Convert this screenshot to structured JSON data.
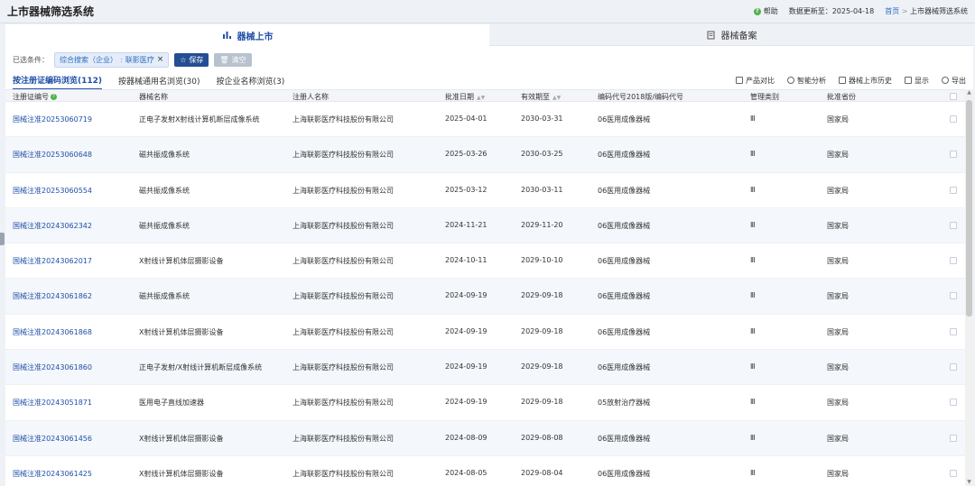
{
  "app": {
    "title": "上市器械筛选系统"
  },
  "topbar": {
    "help": "帮助",
    "update_label": "数据更新至：2025-04-18",
    "breadcrumb_home": "首页",
    "breadcrumb_sep": ">",
    "breadcrumb_current": "上市器械筛选系统"
  },
  "tabs": [
    {
      "label": "器械上市",
      "active": true
    },
    {
      "label": "器械备案",
      "active": false
    }
  ],
  "filters": {
    "label": "已选条件：",
    "chip_part1": "综合搜索（企业）",
    "chip_sep": ":",
    "chip_part2": "联影医疗",
    "save_label": "保存",
    "clear_label": "清空"
  },
  "browse_tabs": [
    {
      "label": "按注册证编码浏览(112)",
      "active": true
    },
    {
      "label": "按器械通用名浏览(30)",
      "active": false
    },
    {
      "label": "按企业名称浏览(3)",
      "active": false
    }
  ],
  "tools": [
    "产品对比",
    "智能分析",
    "器械上市历史",
    "显示",
    "导出"
  ],
  "table": {
    "headers": [
      "注册证编号",
      "器械名称",
      "注册人名称",
      "批准日期",
      "有效期至",
      "编码代号2018版/编码代号",
      "管理类别",
      "批准省份"
    ],
    "rows": [
      [
        "国械注准20253060719",
        "正电子发射X射线计算机断层成像系统",
        "上海联影医疗科技股份有限公司",
        "2025-04-01",
        "2030-03-31",
        "06医用成像器械",
        "Ⅲ",
        "国家局"
      ],
      [
        "国械注准20253060648",
        "磁共振成像系统",
        "上海联影医疗科技股份有限公司",
        "2025-03-26",
        "2030-03-25",
        "06医用成像器械",
        "Ⅲ",
        "国家局"
      ],
      [
        "国械注准20253060554",
        "磁共振成像系统",
        "上海联影医疗科技股份有限公司",
        "2025-03-12",
        "2030-03-11",
        "06医用成像器械",
        "Ⅲ",
        "国家局"
      ],
      [
        "国械注准20243062342",
        "磁共振成像系统",
        "上海联影医疗科技股份有限公司",
        "2024-11-21",
        "2029-11-20",
        "06医用成像器械",
        "Ⅲ",
        "国家局"
      ],
      [
        "国械注准20243062017",
        "X射线计算机体层摄影设备",
        "上海联影医疗科技股份有限公司",
        "2024-10-11",
        "2029-10-10",
        "06医用成像器械",
        "Ⅲ",
        "国家局"
      ],
      [
        "国械注准20243061862",
        "磁共振成像系统",
        "上海联影医疗科技股份有限公司",
        "2024-09-19",
        "2029-09-18",
        "06医用成像器械",
        "Ⅲ",
        "国家局"
      ],
      [
        "国械注准20243061868",
        "X射线计算机体层摄影设备",
        "上海联影医疗科技股份有限公司",
        "2024-09-19",
        "2029-09-18",
        "06医用成像器械",
        "Ⅲ",
        "国家局"
      ],
      [
        "国械注准20243061860",
        "正电子发射/X射线计算机断层成像系统",
        "上海联影医疗科技股份有限公司",
        "2024-09-19",
        "2029-09-18",
        "06医用成像器械",
        "Ⅲ",
        "国家局"
      ],
      [
        "国械注准20243051871",
        "医用电子直线加速器",
        "上海联影医疗科技股份有限公司",
        "2024-09-19",
        "2029-09-18",
        "05放射治疗器械",
        "Ⅲ",
        "国家局"
      ],
      [
        "国械注准20243061456",
        "X射线计算机体层摄影设备",
        "上海联影医疗科技股份有限公司",
        "2024-08-09",
        "2029-08-08",
        "06医用成像器械",
        "Ⅲ",
        "国家局"
      ],
      [
        "国械注准20243061425",
        "X射线计算机体层摄影设备",
        "上海联影医疗科技股份有限公司",
        "2024-08-05",
        "2029-08-04",
        "06医用成像器械",
        "Ⅲ",
        "国家局"
      ]
    ]
  },
  "colors": {
    "accent": "#1f4fa8",
    "save_button": "#244e94",
    "help_green": "#52b34a"
  }
}
